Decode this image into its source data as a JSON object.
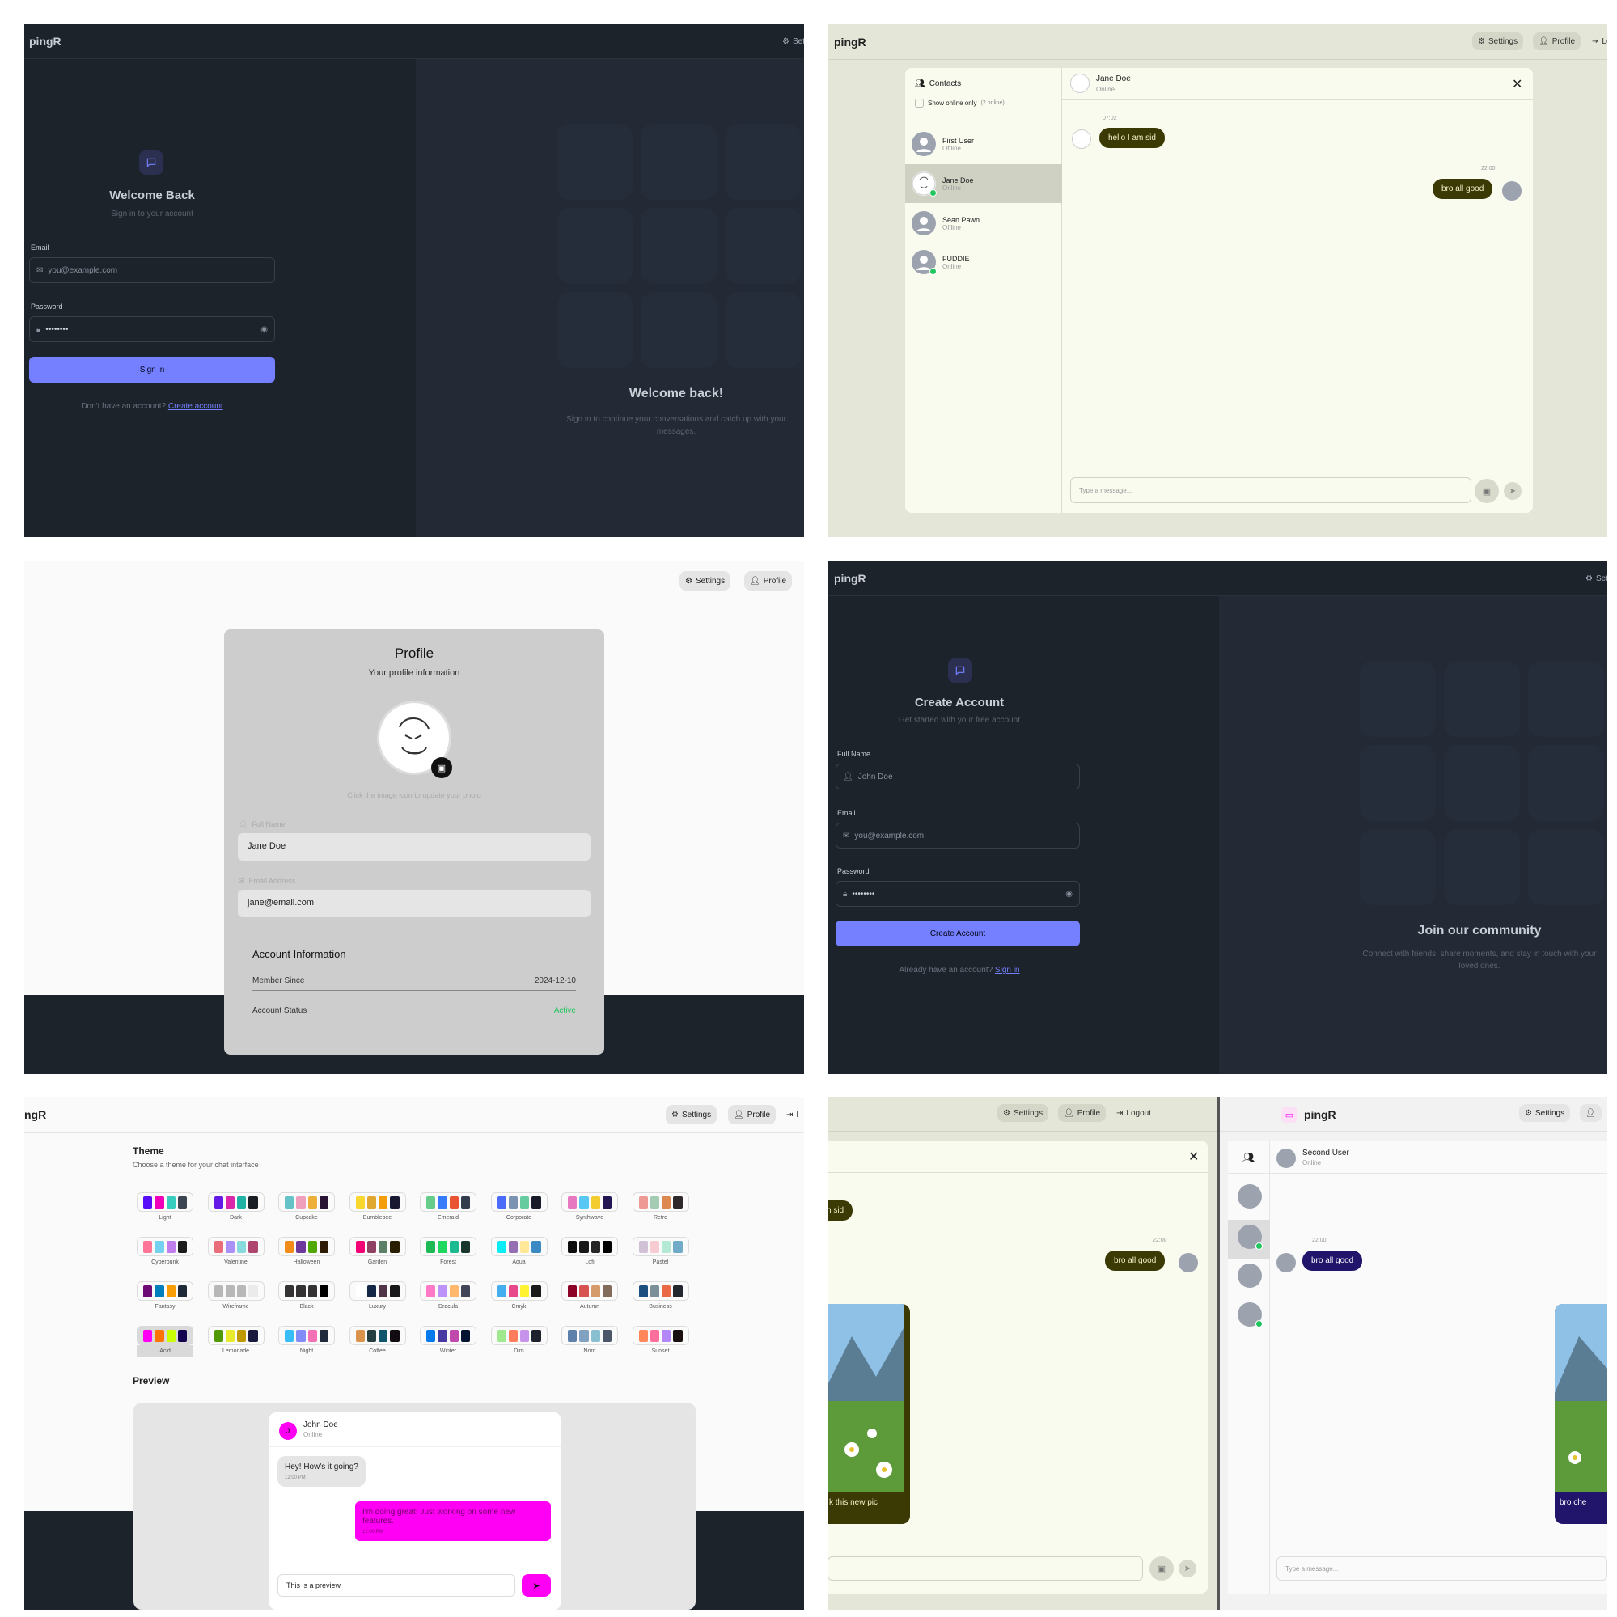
{
  "app": {
    "name": "pingR",
    "settings": "Settings",
    "profile": "Profile",
    "logout": "Logout",
    "sett_trunc": "Sett",
    "app_trunc": "ngR"
  },
  "login": {
    "title": "Welcome Back",
    "subtitle": "Sign in to your account",
    "email_label": "Email",
    "email_placeholder": "you@example.com",
    "password_label": "Password",
    "password_value": "••••••••",
    "button": "Sign in",
    "footer": "Don't have an account?",
    "footer_link": "Create account",
    "right_title": "Welcome back!",
    "right_text": "Sign in to continue your conversations and catch up with your messages."
  },
  "chat": {
    "contacts_title": "Contacts",
    "show_online": "Show online only",
    "online_count": "(2 online)",
    "contacts": [
      {
        "name": "First User",
        "status": "Offline"
      },
      {
        "name": "Jane Doe",
        "status": "Online"
      },
      {
        "name": "Sean Pawn",
        "status": "Offline"
      },
      {
        "name": "FUDDIE",
        "status": "Online"
      }
    ],
    "header_name": "Jane Doe",
    "header_status": "Online",
    "messages": [
      {
        "time": "07:02",
        "text": "hello I am sid"
      },
      {
        "time": "22:00",
        "text": "bro all good"
      }
    ],
    "input_placeholder": "Type a message..."
  },
  "profile": {
    "title": "Profile",
    "subtitle": "Your profile information",
    "hint": "Click the image icon to update your photo",
    "name_label": "Full Name",
    "name_value": "Jane Doe",
    "email_label": "Email Address",
    "email_value": "jane@email.com",
    "account_title": "Account Information",
    "member_label": "Member Since",
    "member_value": "2024-12-10",
    "status_label": "Account Status",
    "status_value": "Active"
  },
  "signup": {
    "title": "Create Account",
    "subtitle": "Get started with your free account",
    "name_label": "Full Name",
    "name_placeholder": "John Doe",
    "email_label": "Email",
    "email_placeholder": "you@example.com",
    "password_label": "Password",
    "password_value": "••••••••",
    "button": "Create Account",
    "footer": "Already have an account?",
    "footer_link": "Sign in",
    "right_title": "Join our community",
    "right_text": "Connect with friends, share moments, and stay in touch with your loved ones."
  },
  "settings": {
    "theme_title": "Theme",
    "theme_subtitle": "Choose a theme for your chat interface",
    "themes": [
      {
        "name": "Light",
        "colors": [
          "#570df8",
          "#f000b8",
          "#37cdbe",
          "#3d4451"
        ]
      },
      {
        "name": "Dark",
        "colors": [
          "#661ae6",
          "#d926aa",
          "#1fb2a5",
          "#191d24"
        ]
      },
      {
        "name": "Cupcake",
        "colors": [
          "#65c3c8",
          "#ef9fbc",
          "#eeaf3a",
          "#291334"
        ]
      },
      {
        "name": "Bumblebee",
        "colors": [
          "#f9d72f",
          "#e0a82e",
          "#f59e0b",
          "#181830"
        ]
      },
      {
        "name": "Emerald",
        "colors": [
          "#66cc8a",
          "#377cfb",
          "#ea5234",
          "#333c4d"
        ]
      },
      {
        "name": "Corporate",
        "colors": [
          "#4b6bfb",
          "#7b92b2",
          "#67cba0",
          "#181a2a"
        ]
      },
      {
        "name": "Synthwave",
        "colors": [
          "#e779c1",
          "#58c7f3",
          "#f3cc30",
          "#221551"
        ]
      },
      {
        "name": "Retro",
        "colors": [
          "#ef9995",
          "#a4cbb4",
          "#dc8850",
          "#2e282a"
        ]
      },
      {
        "name": "Cyberpunk",
        "colors": [
          "#ff7598",
          "#75d1f0",
          "#c07eec",
          "#1c1c1c"
        ]
      },
      {
        "name": "Valentine",
        "colors": [
          "#e96d7b",
          "#a991f7",
          "#88dbdd",
          "#af4670"
        ]
      },
      {
        "name": "Halloween",
        "colors": [
          "#f28c18",
          "#6d3a9c",
          "#51a800",
          "#2f1b05"
        ]
      },
      {
        "name": "Garden",
        "colors": [
          "#f40076",
          "#8e4162",
          "#5c7f67",
          "#291e00"
        ]
      },
      {
        "name": "Forest",
        "colors": [
          "#1eb854",
          "#1fd65f",
          "#1db990",
          "#19362d"
        ]
      },
      {
        "name": "Aqua",
        "colors": [
          "#09ecf3",
          "#966fb3",
          "#ffe999",
          "#3b8ac4"
        ]
      },
      {
        "name": "Lofi",
        "colors": [
          "#0d0d0d",
          "#1a1919",
          "#262626",
          "#000000"
        ]
      },
      {
        "name": "Pastel",
        "colors": [
          "#d1c1d7",
          "#f6cbd1",
          "#b4e9d6",
          "#70acc7"
        ]
      },
      {
        "name": "Fantasy",
        "colors": [
          "#6e0b75",
          "#007ebd",
          "#f89c08",
          "#1f2937"
        ]
      },
      {
        "name": "Wireframe",
        "colors": [
          "#b8b8b8",
          "#b8b8b8",
          "#b8b8b8",
          "#ebebeb"
        ]
      },
      {
        "name": "Black",
        "colors": [
          "#343232",
          "#343232",
          "#343232",
          "#000000"
        ]
      },
      {
        "name": "Luxury",
        "colors": [
          "#ffffff",
          "#152747",
          "#513448",
          "#171618"
        ]
      },
      {
        "name": "Dracula",
        "colors": [
          "#ff79c6",
          "#bd93f9",
          "#ffb86c",
          "#414558"
        ]
      },
      {
        "name": "Cmyk",
        "colors": [
          "#45aeee",
          "#e8488a",
          "#fff232",
          "#1a1a1a"
        ]
      },
      {
        "name": "Autumn",
        "colors": [
          "#8c0327",
          "#d85251",
          "#d59b6a",
          "#826a5c"
        ]
      },
      {
        "name": "Business",
        "colors": [
          "#1c4e80",
          "#7c909a",
          "#ea6947",
          "#23282e"
        ]
      },
      {
        "name": "Acid",
        "colors": [
          "#ff00f4",
          "#ff7400",
          "#cbfd03",
          "#140152"
        ]
      },
      {
        "name": "Lemonade",
        "colors": [
          "#519903",
          "#e9e92e",
          "#bf9900",
          "#191a3e"
        ]
      },
      {
        "name": "Night",
        "colors": [
          "#38bdf8",
          "#818cf8",
          "#f471b5",
          "#1e293b"
        ]
      },
      {
        "name": "Coffee",
        "colors": [
          "#db924b",
          "#263e3f",
          "#10576d",
          "#120c12"
        ]
      },
      {
        "name": "Winter",
        "colors": [
          "#047aed",
          "#463aa2",
          "#c148ac",
          "#021431"
        ]
      },
      {
        "name": "Dim",
        "colors": [
          "#9fe88d",
          "#ff7d5c",
          "#c792e9",
          "#1c212b"
        ]
      },
      {
        "name": "Nord",
        "colors": [
          "#5e81ac",
          "#81a1c1",
          "#88c0d0",
          "#4c566a"
        ]
      },
      {
        "name": "Sunset",
        "colors": [
          "#ff865b",
          "#fd6f9c",
          "#b387fa",
          "#1a0f0f"
        ]
      }
    ],
    "preview_title": "Preview",
    "preview_name": "John Doe",
    "preview_status": "Online",
    "preview_initial": "J",
    "preview_msg1": "Hey! How's it going?",
    "preview_time1": "12:00 PM",
    "preview_msg2": "I'm doing great! Just working on some new features.",
    "preview_time2": "12:00 PM",
    "preview_input": "This is a preview"
  },
  "split": {
    "left_partial_msg": "n sid",
    "left_time": "22:00",
    "left_msg": "bro all good",
    "left_caption": "k this new pic",
    "right_name": "Second User",
    "right_status": "Online",
    "right_time": "22:00",
    "right_msg": "bro all good",
    "right_caption": "bro che",
    "input_placeholder": "Type a message..."
  }
}
